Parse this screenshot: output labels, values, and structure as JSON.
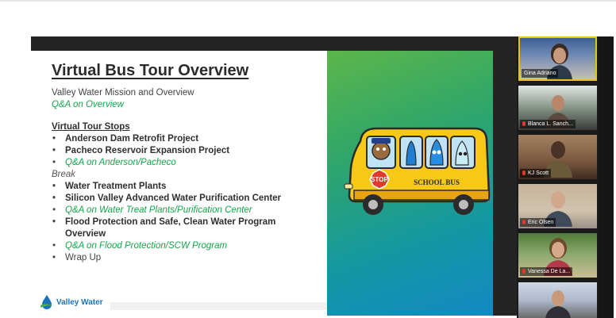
{
  "slide": {
    "title": "Virtual Bus Tour Overview",
    "intro": "Valley Water Mission and Overview",
    "intro_qa": "Q&A on Overview",
    "stops_heading": "Virtual Tour Stops",
    "stops_a": [
      "Anderson Dam Retrofit Project",
      "Pacheco Reservoir Expansion Project"
    ],
    "qa_a": "Q&A on Anderson/Pacheco",
    "break_label": "Break",
    "stops_b": [
      "Water Treatment Plants",
      "Silicon Valley Advanced Water Purification Center"
    ],
    "qa_b": "Q&A on Water Treat Plants/Purification Center",
    "stop_c_line1": "Flood Protection and Safe, Clean Water Program",
    "stop_c_line2": "Overview",
    "qa_c": "Q&A on Flood Protection/SCW Program",
    "wrap": "Wrap Up",
    "logo_text": "Valley Water",
    "illustration": {
      "stop_sign": "STOP",
      "bus_label": "SCHOOL BUS"
    }
  },
  "participants": [
    {
      "name": "Gina Adriano",
      "active_speaker": true
    },
    {
      "name": "Blanca L. Sanch..."
    },
    {
      "name": "KJ Scott"
    },
    {
      "name": "Eric Olsen"
    },
    {
      "name": "Vanessa De La..."
    },
    {
      "name": ""
    }
  ],
  "colors": {
    "accent_green": "#17a34a",
    "logo_blue": "#1b74b8",
    "speaker_border": "#e8c21b",
    "mic_muted": "#e0392d"
  }
}
